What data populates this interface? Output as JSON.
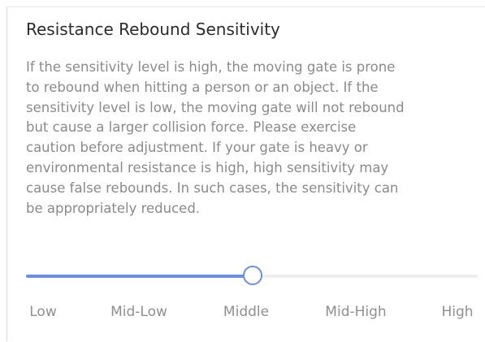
{
  "setting": {
    "title": "Resistance Rebound Sensitivity",
    "description_lines": [
      "If the sensitivity level is high, the moving gate is prone",
      "to rebound when hitting a person or an object. If the",
      "sensitivity level is low, the moving gate will not rebound",
      "but cause a larger collision force. Please exercise",
      "caution before adjustment. If your gate is heavy or",
      "environmental resistance is high, high sensitivity may",
      "cause false rebounds. In such cases, the sensitivity can",
      "be appropriately reduced."
    ]
  },
  "slider": {
    "levels": [
      "Low",
      "Mid-Low",
      "Middle",
      "Mid-High",
      "High"
    ],
    "selected_level": "Middle",
    "value_fraction": 0.5,
    "accent_color": "#6b8ee6",
    "track_color": "#eeeeee"
  }
}
